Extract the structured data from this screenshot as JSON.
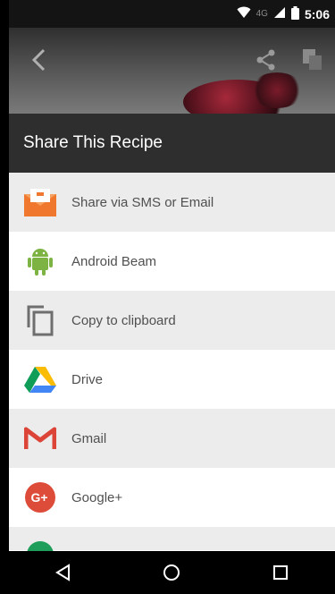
{
  "status_bar": {
    "time": "5:06",
    "network": "4G"
  },
  "dialog": {
    "title": "Share This Recipe",
    "items": [
      {
        "label": "Share via SMS or Email",
        "icon": "sms-email-icon"
      },
      {
        "label": "Android Beam",
        "icon": "android-icon"
      },
      {
        "label": "Copy to clipboard",
        "icon": "copy-icon"
      },
      {
        "label": "Drive",
        "icon": "drive-icon"
      },
      {
        "label": "Gmail",
        "icon": "gmail-icon"
      },
      {
        "label": "Google+",
        "icon": "google-plus-icon"
      }
    ]
  },
  "colors": {
    "header_bg": "#2e2e2e",
    "row_gray": "#ececec",
    "text": "#505050"
  }
}
